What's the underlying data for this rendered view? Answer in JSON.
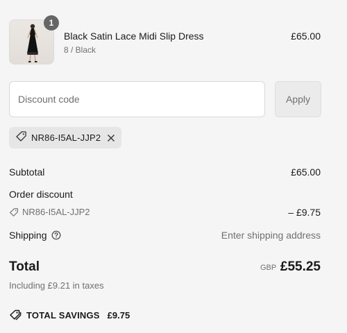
{
  "product": {
    "quantity": "1",
    "name": "Black Satin Lace Midi Slip Dress",
    "variant": "8 / Black",
    "price": "£65.00",
    "image_icon": "dress-product-image"
  },
  "discount": {
    "placeholder": "Discount code",
    "apply_label": "Apply",
    "applied_code": "NR86-I5AL-JJP2"
  },
  "summary": {
    "subtotal_label": "Subtotal",
    "subtotal_value": "£65.00",
    "order_discount_label": "Order discount",
    "order_discount_code": "NR86-I5AL-JJP2",
    "order_discount_value": "– £9.75",
    "shipping_label": "Shipping",
    "shipping_value": "Enter shipping address",
    "total_label": "Total",
    "total_currency": "GBP",
    "total_value": "£55.25",
    "taxes_note": "Including £9.21 in taxes",
    "savings_label": "TOTAL SAVINGS",
    "savings_value": "£9.75"
  },
  "colors": {
    "background": "#f5f5f5",
    "badge": "#666666",
    "chip": "#e6e6e6",
    "muted_text": "#707070"
  }
}
